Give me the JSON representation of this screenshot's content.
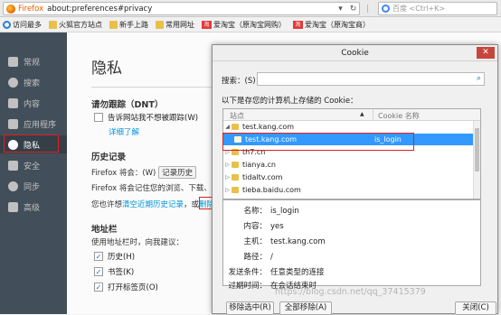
{
  "urlbar": {
    "brand": "Firefox",
    "url": "about:preferences#privacy",
    "search_engine": "百度",
    "search_placeholder": "百度 <Ctrl+K>"
  },
  "bookmarks": [
    {
      "label": "访问最多",
      "icon": "gear-icon"
    },
    {
      "label": "火狐官方站点",
      "icon": "folder-icon"
    },
    {
      "label": "新手上路",
      "icon": "folder-icon"
    },
    {
      "label": "常用网址",
      "icon": "folder-icon"
    },
    {
      "label": "爱淘宝（原淘宝网购）",
      "icon": "taobao-icon",
      "badge": "淘"
    },
    {
      "label": "爱淘宝（原淘宝商）",
      "icon": "taobao-icon",
      "badge": "淘"
    }
  ],
  "sidebar": {
    "items": [
      {
        "label": "常规",
        "icon": "general-icon"
      },
      {
        "label": "搜索",
        "icon": "search-icon"
      },
      {
        "label": "内容",
        "icon": "content-icon"
      },
      {
        "label": "应用程序",
        "icon": "applications-icon"
      },
      {
        "label": "隐私",
        "icon": "privacy-mask-icon"
      },
      {
        "label": "安全",
        "icon": "security-icon"
      },
      {
        "label": "同步",
        "icon": "sync-icon"
      },
      {
        "label": "高级",
        "icon": "advanced-icon"
      }
    ],
    "active_index": 4
  },
  "privacy": {
    "title": "隐私",
    "dnt_heading": "请勿跟踪（DNT）",
    "dnt_checkbox": "告诉网站我不想被跟踪(W)",
    "dnt_checked": false,
    "learn_more": "详细了解",
    "history_heading": "历史记录",
    "history_prefix": "Firefox 将会：(W)",
    "history_select": "记录历史",
    "history_desc": "Firefox 将会记住您的浏览、下载、",
    "history_clear_prefix": "您也许想",
    "history_clear_link": "清空近期历史记录",
    "history_clear_mid": "，或",
    "history_remove_link": "删除",
    "addressbar_heading": "地址栏",
    "addressbar_desc": "使用地址栏时，向我建议：",
    "suggest_history": "历史(H)",
    "suggest_bookmarks": "书签(K)",
    "suggest_tabs": "打开标签页(O)"
  },
  "cookie_dialog": {
    "title": "Cookie",
    "close_glyph": "✕",
    "search_label": "搜索：(S)",
    "search_value": "",
    "caption": "以下是存您的计算机上存储的 Cookie：",
    "columns": {
      "site": "站点",
      "name": "Cookie 名称"
    },
    "rows": [
      {
        "site": "test.kang.com",
        "cookie": "",
        "expanded": true,
        "level": 0
      },
      {
        "site": "test.kang.com",
        "cookie": "is_login",
        "selected": true,
        "level": 1
      },
      {
        "site": "th7.cn",
        "cookie": "",
        "level": 0
      },
      {
        "site": "tianya.cn",
        "cookie": "",
        "level": 0
      },
      {
        "site": "tidaltv.com",
        "cookie": "",
        "level": 0
      },
      {
        "site": "tieba.baidu.com",
        "cookie": "",
        "level": 0
      }
    ],
    "details": [
      {
        "label": "名称：",
        "value": "is_login"
      },
      {
        "label": "内容：",
        "value": "yes"
      },
      {
        "label": "主机：",
        "value": "test.kang.com"
      },
      {
        "label": "路径：",
        "value": "/"
      },
      {
        "label": "发送条件：",
        "value": "任意类型的连接"
      },
      {
        "label": "过期时间：",
        "value": "在会话结束时"
      }
    ],
    "buttons": {
      "remove_selected": "移除选中(R)",
      "remove_all": "全部移除(A)",
      "close": "关闭(C)"
    }
  },
  "watermark": "https://blog.csdn.net/qq_37415379",
  "colors": {
    "accent": "#0095dd",
    "highlight": "#e02020",
    "sidebar_bg": "#424f5a",
    "selection": "#3399ff"
  }
}
